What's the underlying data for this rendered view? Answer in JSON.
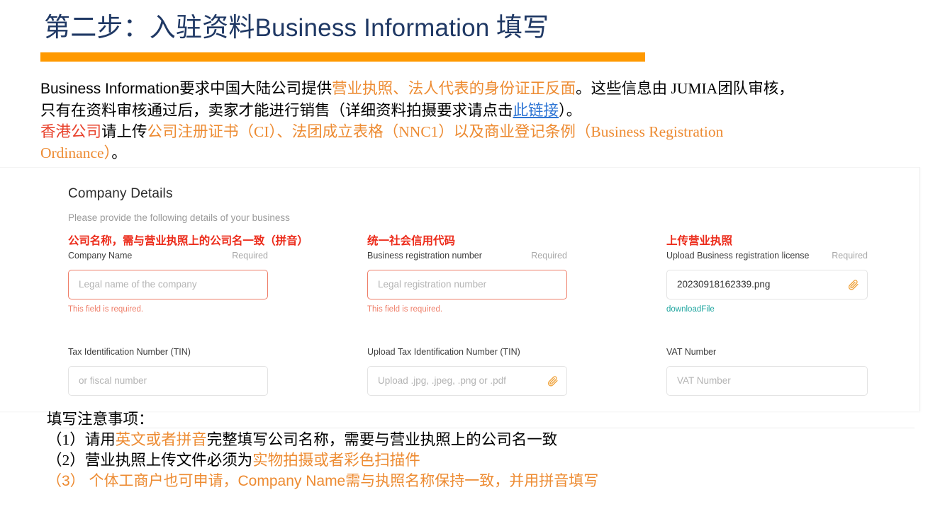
{
  "slide": {
    "title_cn_prefix": "第二步：入驻资料",
    "title_latin": "Business Information",
    "title_cn_suffix": " 填写",
    "accent_orange": "#ff9900",
    "title_color": "#1f3864"
  },
  "intro": {
    "line1_a": "Business Information",
    "line1_b": "要求中国大陆公司提供",
    "line1_c": "营业执照、法人代表的身份证正反面",
    "line1_d": "。这些信息由 JUMIA团队审核，",
    "line2_a": "只有在资料审核通过后，卖家才能进行销售（详细资料拍摄要求请点击",
    "line2_link": "此链接",
    "line2_b": "）。",
    "line3_a": "香港公司",
    "line3_b": "请上传",
    "line3_c": "公司注册证书（CI）、法团成立表格（NNC1）以及商业登记条例（Business Registration",
    "line4_a": "Ordinance）",
    "line4_b": "。",
    "link_color": "#2e75d4",
    "orange": "#ed8b32",
    "red": "#e8402a"
  },
  "form": {
    "card_title": "Company Details",
    "card_subtitle": "Please provide the following details of your business",
    "fields": [
      {
        "cn_label": "公司名称，需与营业执照上的公司名一致（拼音）",
        "label": "Company Name",
        "required_flag": "Required",
        "placeholder": "Legal name of the company",
        "error": "This field is required."
      },
      {
        "cn_label": "统一社会信用代码",
        "label": "Business registration number",
        "required_flag": "Required",
        "placeholder": "Legal registration number",
        "error": "This field is required."
      },
      {
        "cn_label": "上传营业执照",
        "label": "Upload Business registration license",
        "required_flag": "Required",
        "value": "20230918162339.png",
        "download_link": "downloadFile",
        "icon": "paperclip-icon"
      },
      {
        "label": "Tax Identification Number (TIN)",
        "placeholder": "or fiscal number"
      },
      {
        "label": "Upload Tax Identification Number (TIN)",
        "placeholder": "Upload .jpg, .jpeg, .png or .pdf",
        "icon": "paperclip-icon"
      },
      {
        "label": "VAT Number",
        "placeholder": "VAT Number"
      }
    ],
    "error_color": "#ef7f6a",
    "cn_label_color": "#ec2b1a",
    "download_color": "#20a6a0"
  },
  "notes": {
    "heading": "填写注意事项：",
    "item1_a": "（1）请用",
    "item1_b": "英文或者拼音",
    "item1_c": "完整填写公司名称，需要与营业执照上的公司名一致",
    "item2_a": "（2）营业执照上传文件必须为",
    "item2_b": "实物拍摄或者彩色扫描件",
    "item3": "（3） 个体工商户也可申请，Company Name需与执照名称保持一致，并用拼音填写"
  }
}
